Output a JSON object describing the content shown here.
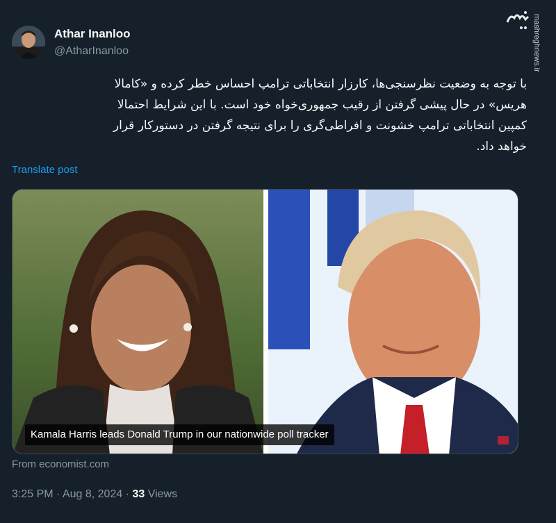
{
  "author": {
    "display_name": "Athar Inanloo",
    "handle": "@AtharInanloo"
  },
  "watermark": {
    "site": "mashreghnews.ir",
    "logo_text": "مشرق"
  },
  "tweet": {
    "lines": [
      "با توجه به وضعیت نظرسنجی‌ها، کارزار انتخاباتی ترامپ احساس خطر کرده و «کامالا",
      "هریس» در حال پیشی گرفتن از رقیب جمهوری‌خواه خود است. با این شرایط احتمالا",
      "کمپین انتخاباتی ترامپ خشونت و افراطی‌گری را برای نتیجه گرفتن در دستورکار قرار",
      "خواهد داد."
    ],
    "translate_label": "Translate post"
  },
  "media": {
    "caption": "Kamala Harris leads Donald Trump in our nationwide poll tracker",
    "source": "From economist.com"
  },
  "meta": {
    "time": "3:25 PM",
    "separator1": " · ",
    "date": "Aug 8, 2024",
    "separator2": " · ",
    "views_count": "33",
    "views_label": " Views"
  },
  "colors": {
    "background": "#15202b",
    "link": "#1d9bf0",
    "secondary_text": "#8b98a5"
  }
}
